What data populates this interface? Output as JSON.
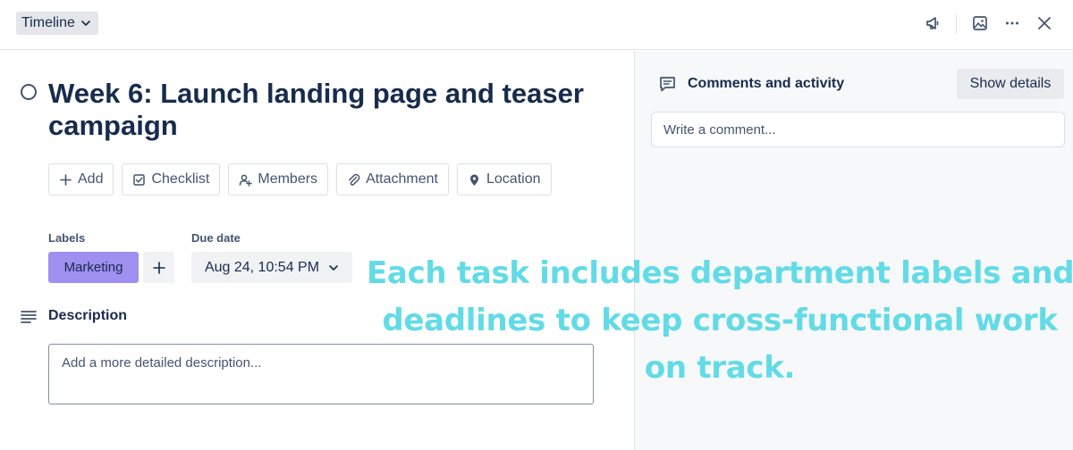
{
  "header": {
    "list_name": "Timeline",
    "icons": [
      "megaphone-icon",
      "image-icon",
      "more-icon",
      "close-icon"
    ]
  },
  "card": {
    "title": "Week 6: Launch landing page and teaser campaign",
    "actions": [
      {
        "label": "Add",
        "icon": "plus-icon"
      },
      {
        "label": "Checklist",
        "icon": "checklist-icon"
      },
      {
        "label": "Members",
        "icon": "add-member-icon"
      },
      {
        "label": "Attachment",
        "icon": "paperclip-icon"
      },
      {
        "label": "Location",
        "icon": "location-pin-icon"
      }
    ],
    "labels_heading": "Labels",
    "label": {
      "text": "Marketing",
      "color": "#9f8fef"
    },
    "due_heading": "Due date",
    "due_value": "Aug 24, 10:54 PM",
    "description_heading": "Description",
    "description_placeholder": "Add a more detailed description..."
  },
  "activity": {
    "heading": "Comments and activity",
    "show_details": "Show details",
    "comment_placeholder": "Write a comment..."
  },
  "overlay_caption": {
    "lines": [
      "Each task includes department labels and",
      "deadlines to keep cross-functional work",
      "on track."
    ],
    "color": "#62dbe6"
  }
}
